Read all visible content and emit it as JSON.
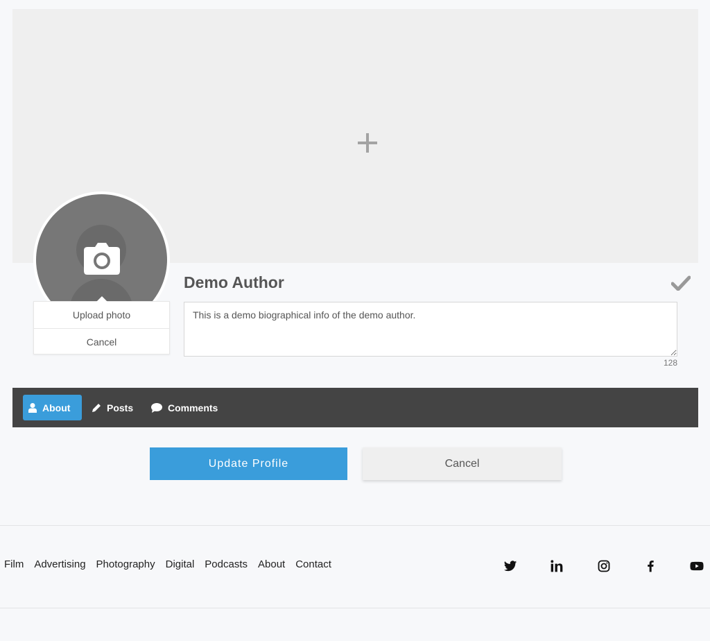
{
  "profile": {
    "name": "Demo Author",
    "bio": "This is a demo biographical info of the demo author.",
    "char_count": "128"
  },
  "avatar_menu": {
    "upload_label": "Upload photo",
    "cancel_label": "Cancel"
  },
  "tabs": [
    {
      "label": "About",
      "icon": "user-icon",
      "active": true
    },
    {
      "label": "Posts",
      "icon": "pencil-icon",
      "active": false
    },
    {
      "label": "Comments",
      "icon": "comment-icon",
      "active": false
    }
  ],
  "actions": {
    "update_label": "Update Profile",
    "cancel_label": "Cancel"
  },
  "footer": {
    "links": [
      "Film",
      "Advertising",
      "Photography",
      "Digital",
      "Podcasts",
      "About",
      "Contact"
    ],
    "social": [
      "twitter-icon",
      "linkedin-icon",
      "instagram-icon",
      "facebook-icon",
      "youtube-icon"
    ]
  },
  "colors": {
    "accent": "#3a9ddb",
    "tabbar": "#444444",
    "cover": "#efefef"
  }
}
